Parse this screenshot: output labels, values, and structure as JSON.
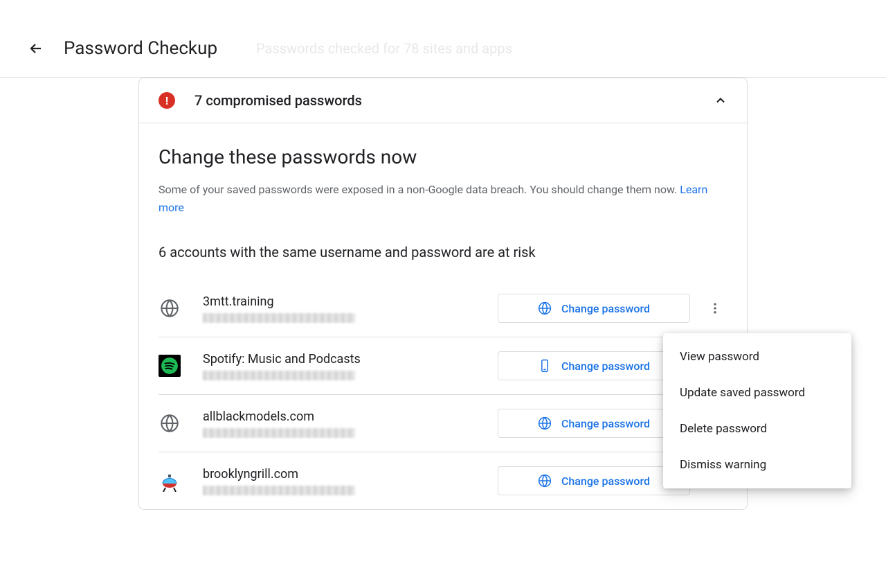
{
  "header": {
    "title": "Password Checkup",
    "ghost": "Passwords checked for 78 sites and apps"
  },
  "card": {
    "alert_title": "7 compromised passwords",
    "section_title": "Change these passwords now",
    "section_desc": "Some of your saved passwords were exposed in a non-Google data breach. You should change them now. ",
    "learn_more": "Learn more",
    "subsection": "6 accounts with the same username and password are at risk"
  },
  "items": [
    {
      "site": "3mtt.training",
      "icon": "globe",
      "btn_icon": "globe",
      "label": "Change password"
    },
    {
      "site": "Spotify: Music and Podcasts",
      "icon": "spotify",
      "btn_icon": "phone",
      "label": "Change password"
    },
    {
      "site": "allblackmodels.com",
      "icon": "globe",
      "btn_icon": "globe",
      "label": "Change password"
    },
    {
      "site": "brooklyngrill.com",
      "icon": "grill",
      "btn_icon": "globe",
      "label": "Change password"
    }
  ],
  "menu": {
    "view": "View password",
    "update": "Update saved password",
    "delete": "Delete password",
    "dismiss": "Dismiss warning"
  }
}
